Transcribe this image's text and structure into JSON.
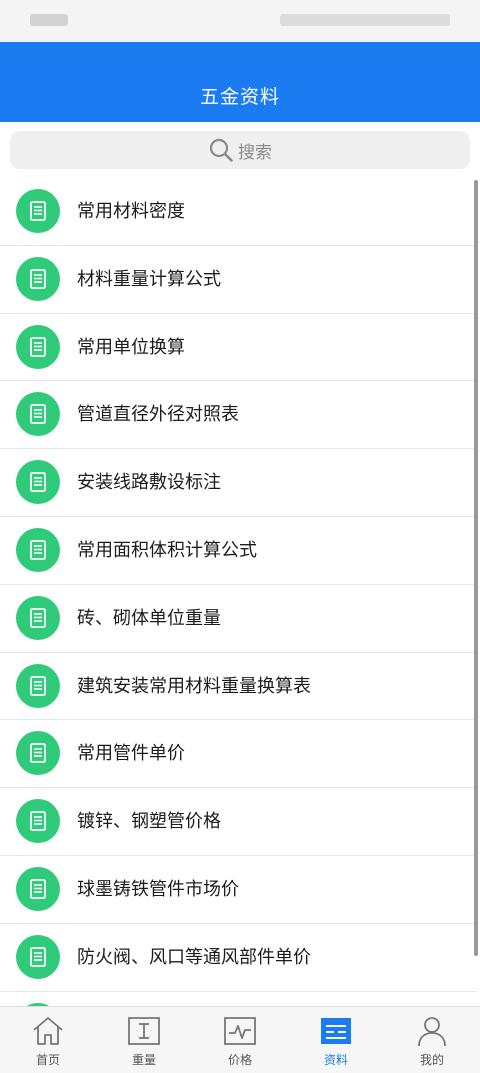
{
  "header": {
    "title": "五金资料"
  },
  "search": {
    "placeholder": "搜索"
  },
  "list": {
    "items": [
      {
        "label": "常用材料密度"
      },
      {
        "label": "材料重量计算公式"
      },
      {
        "label": "常用单位换算"
      },
      {
        "label": "管道直径外径对照表"
      },
      {
        "label": "安装线路敷设标注"
      },
      {
        "label": "常用面积体积计算公式"
      },
      {
        "label": "砖、砌体单位重量"
      },
      {
        "label": "建筑安装常用材料重量换算表"
      },
      {
        "label": "常用管件单价"
      },
      {
        "label": "镀锌、钢塑管价格"
      },
      {
        "label": "球墨铸铁管件市场价"
      },
      {
        "label": "防火阀、风口等通风部件单价"
      }
    ]
  },
  "tabs": [
    {
      "label": "首页",
      "icon": "home-icon"
    },
    {
      "label": "重量",
      "icon": "weight-icon"
    },
    {
      "label": "价格",
      "icon": "price-chart-icon"
    },
    {
      "label": "资料",
      "icon": "document-list-icon",
      "active": true
    },
    {
      "label": "我的",
      "icon": "user-icon"
    }
  ],
  "colors": {
    "accent": "#1a7cf0",
    "item_icon": "#2fcb7a"
  }
}
